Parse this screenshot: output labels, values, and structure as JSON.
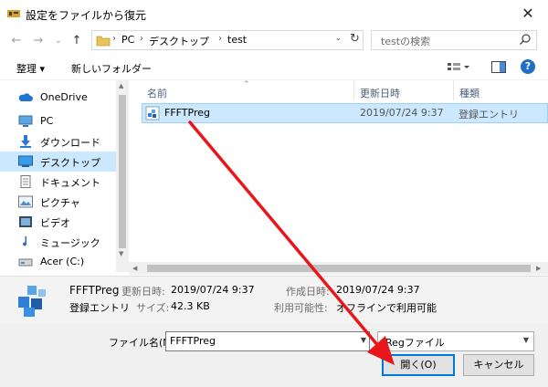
{
  "window": {
    "title": "設定をファイルから復元",
    "close_glyph": "✕"
  },
  "address_bar": {
    "back_glyph": "←",
    "forward_glyph": "→",
    "dropdown_glyph": "⌄",
    "up_glyph": "↑",
    "breadcrumbs": [
      "PC",
      "デスクトップ",
      "test"
    ],
    "separator": "›",
    "refresh_glyph": "↻"
  },
  "search": {
    "placeholder": "testの検索"
  },
  "toolbar": {
    "organize_label": "整理 ▾",
    "new_folder_label": "新しいフォルダー",
    "help_glyph": "?"
  },
  "nav": {
    "items": [
      {
        "label": "OneDrive",
        "icon": "cloud-icon"
      },
      {
        "label": "PC",
        "icon": "computer-icon"
      },
      {
        "label": "ダウンロード",
        "icon": "download-icon"
      },
      {
        "label": "デスクトップ",
        "icon": "desktop-icon",
        "selected": true
      },
      {
        "label": "ドキュメント",
        "icon": "document-icon"
      },
      {
        "label": "ピクチャ",
        "icon": "picture-icon"
      },
      {
        "label": "ビデオ",
        "icon": "video-icon"
      },
      {
        "label": "ミュージック",
        "icon": "music-icon"
      },
      {
        "label": "Acer (C:)",
        "icon": "drive-icon"
      }
    ]
  },
  "file_list": {
    "columns": [
      "名前",
      "更新日時",
      "種類"
    ],
    "rows": [
      {
        "name": "FFFTPreg",
        "modified": "2019/07/24 9:37",
        "type": "登録エントリ",
        "selected": true
      }
    ]
  },
  "details": {
    "name": "FFFTPreg",
    "type": "登録エントリ",
    "modified_label": "更新日時:",
    "modified": "2019/07/24 9:37",
    "size_label": "サイズ:",
    "size": "42.3 KB",
    "created_label": "作成日時:",
    "created": "2019/07/24 9:37",
    "availability_label": "利用可能性:",
    "availability": "オフラインで利用可能"
  },
  "bottom": {
    "filename_label": "ファイル名(N):",
    "filename_value": "FFFTPreg",
    "filetype_value": "Regファイル",
    "open_label": "開く(O)",
    "cancel_label": "キャンセル"
  },
  "colors": {
    "selection": "#cce8ff",
    "selection_border": "#99d1ff",
    "accent": "#0078d7",
    "annotation_arrow": "#e8161b"
  }
}
